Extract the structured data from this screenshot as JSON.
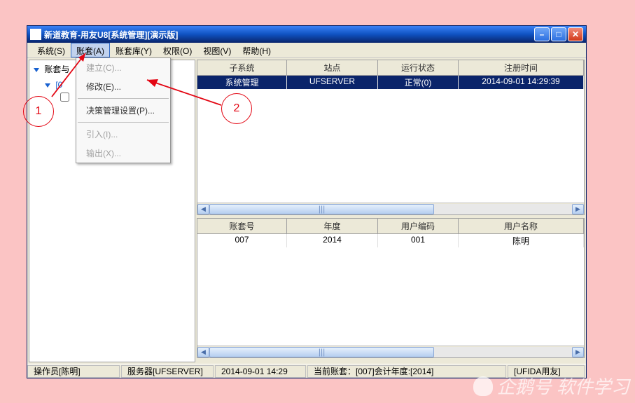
{
  "window": {
    "title": "新道教育-用友U8[系统管理][演示版]"
  },
  "menus": [
    "系统(S)",
    "账套(A)",
    "账套库(Y)",
    "权限(O)",
    "视图(V)",
    "帮助(H)"
  ],
  "tree": {
    "root": "账套与",
    "child": "[0",
    "leaf_checked": false
  },
  "dropdown": {
    "items": [
      {
        "label": "建立(C)...",
        "disabled": true
      },
      {
        "label": "修改(E)...",
        "disabled": false
      },
      {
        "label": "决策管理设置(P)...",
        "disabled": false
      },
      {
        "label": "引入(I)...",
        "disabled": true
      },
      {
        "label": "输出(X)...",
        "disabled": true
      }
    ]
  },
  "grid1": {
    "headers": [
      "子系统",
      "站点",
      "运行状态",
      "注册时间"
    ],
    "rows": [
      [
        "系统管理",
        "UFSERVER",
        "正常(0)",
        "2014-09-01 14:29:39"
      ]
    ]
  },
  "grid2": {
    "headers": [
      "账套号",
      "年度",
      "用户编码",
      "用户名称"
    ],
    "rows": [
      [
        "007",
        "2014",
        "001",
        "陈明"
      ]
    ]
  },
  "status": {
    "operator": "操作员[陈明]",
    "server": "服务器[UFSERVER]",
    "datetime": "2014-09-01 14:29",
    "current": "当前账套：[007]会计年度:[2014]",
    "brand": "[UFIDA用友]"
  },
  "annotations": {
    "label1": "1",
    "label2": "2"
  },
  "watermark": "企鹅号 软件学习"
}
